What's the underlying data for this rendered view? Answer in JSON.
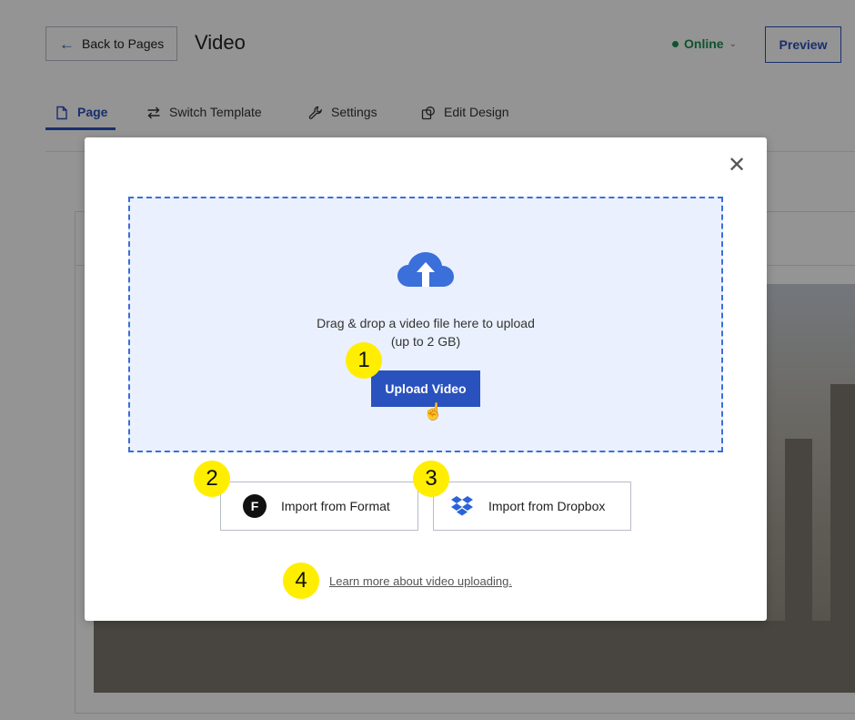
{
  "header": {
    "back_label": "Back to Pages",
    "title": "Video",
    "status": "Online",
    "preview_label": "Preview"
  },
  "tabs": [
    {
      "label": "Page",
      "active": true,
      "icon": "page-icon"
    },
    {
      "label": "Switch Template",
      "icon": "swap-icon"
    },
    {
      "label": "Settings",
      "icon": "wrench-icon"
    },
    {
      "label": "Edit Design",
      "icon": "design-icon"
    }
  ],
  "modal": {
    "drop_text_line1": "Drag & drop a video file here to upload",
    "drop_text_line2": "(up to 2 GB)",
    "upload_label": "Upload Video",
    "import_format_label": "Import from Format",
    "import_dropbox_label": "Import from Dropbox",
    "learn_more_label": "Learn more about video uploading."
  },
  "markers": [
    "1",
    "2",
    "3",
    "4"
  ],
  "colors": {
    "accent": "#2a52be",
    "online": "#1a8f50",
    "marker": "#ffee00",
    "dropzone_bg": "#eaf0fd"
  }
}
